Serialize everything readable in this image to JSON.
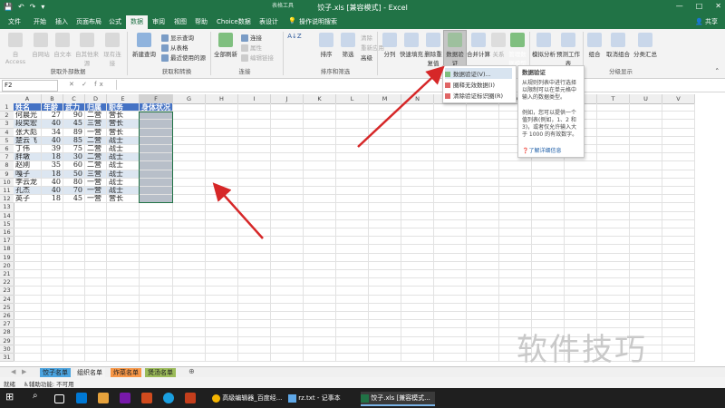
{
  "title_bar": {
    "quick_access": [
      "💾",
      "↶",
      "↷",
      "▾"
    ],
    "table_tools": "表格工具",
    "title": "饺子.xls [兼容模式] - Excel",
    "window_controls": [
      "—",
      "□",
      "✕"
    ]
  },
  "tabs": [
    "文件",
    "开始",
    "插入",
    "页面布局",
    "公式",
    "数据",
    "审阅",
    "视图",
    "帮助",
    "Choice数据",
    "表设计"
  ],
  "active_tab": "数据",
  "tell_me": "操作说明搜索",
  "share": "共享",
  "ribbon": {
    "get_external": {
      "buttons": [
        "自 Access",
        "自网站",
        "自文本",
        "自其他来源",
        "现有连接"
      ],
      "label": "获取外部数据"
    },
    "get_transform": {
      "new_query": "新建查询",
      "small": [
        "显示查询",
        "从表格",
        "最近使用的源"
      ],
      "label": "获取和转换"
    },
    "connections": {
      "refresh": "全部刷新",
      "small": [
        "连接",
        "属性",
        "编辑链接"
      ],
      "label": "连接"
    },
    "sort_filter": {
      "sort_az": "A↓Z",
      "sort": "排序",
      "filter": "筛选",
      "small": [
        "清除",
        "重新应用",
        "高级"
      ],
      "label": "排序和筛选"
    },
    "data_tools": {
      "buttons": [
        "分列",
        "快速填充",
        "删除重复值",
        "数据验证",
        "合并计算",
        "关系",
        "管理数据模型"
      ],
      "label": "数据工具"
    },
    "forecast": {
      "buttons": [
        "模拟分析",
        "预测工作表"
      ],
      "label": "预测"
    },
    "outline": {
      "buttons": [
        "组合",
        "取消组合",
        "分类汇总"
      ],
      "label": "分级显示"
    }
  },
  "data_validation_menu": {
    "items": [
      "数据验证(V)...",
      "圈释无效数据(I)",
      "清除验证标识圈(R)"
    ]
  },
  "tooltip": {
    "title": "数据验证",
    "body1": "从规则列表中进行选择以限制可以在单元格中输入的数据类型。",
    "body2": "例如，您可以提供一个值列表(例如，1、2 和 3)，或者仅允许输入大于 1000 的有效数字。",
    "link": "了解详细信息"
  },
  "formula_bar": {
    "name_box": "F2",
    "fx": "✕ ✓ fx"
  },
  "columns": [
    "A",
    "B",
    "C",
    "D",
    "E",
    "F",
    "G",
    "H",
    "I",
    "J",
    "K",
    "L",
    "M",
    "N",
    "O",
    "P",
    "Q",
    "R",
    "S",
    "T",
    "U",
    "V"
  ],
  "row_numbers": [
    "1",
    "2",
    "3",
    "4",
    "5",
    "6",
    "7",
    "8",
    "9",
    "10",
    "11",
    "12",
    "13",
    "14",
    "15",
    "16",
    "17",
    "18",
    "19",
    "20",
    "21",
    "22",
    "23",
    "24",
    "25",
    "26",
    "27",
    "28",
    "29",
    "30",
    "31"
  ],
  "table": {
    "headers": [
      "姓名",
      "年龄",
      "武力",
      "归属",
      "职务",
      "身体状况"
    ],
    "rows": [
      [
        "何晨光",
        "27",
        "90",
        "二营",
        "营长",
        ""
      ],
      [
        "段奕宏",
        "40",
        "45",
        "三营",
        "营长",
        ""
      ],
      [
        "张大彪",
        "34",
        "89",
        "一营",
        "营长",
        ""
      ],
      [
        "楚云飞",
        "40",
        "85",
        "二营",
        "战士",
        ""
      ],
      [
        "丁伟",
        "39",
        "75",
        "二营",
        "战士",
        ""
      ],
      [
        "胖墩",
        "18",
        "30",
        "二营",
        "战士",
        ""
      ],
      [
        "赵刚",
        "35",
        "60",
        "二营",
        "战士",
        ""
      ],
      [
        "嘎子",
        "18",
        "50",
        "三营",
        "战士",
        ""
      ],
      [
        "李云龙",
        "40",
        "80",
        "一营",
        "战士",
        ""
      ],
      [
        "孔杰",
        "40",
        "70",
        "一营",
        "战士",
        ""
      ],
      [
        "英子",
        "18",
        "45",
        "一营",
        "营长",
        ""
      ]
    ]
  },
  "sheet_tabs": [
    {
      "label": "饺子名单",
      "color": "#4aa3df"
    },
    {
      "label": "组织名单",
      "color": "#f3f3f3"
    },
    {
      "label": "炸菜名单",
      "color": "#f79646"
    },
    {
      "label": "煲汤名单",
      "color": "#9bbb59"
    }
  ],
  "sheet_add": "⊕",
  "status": {
    "ready": "就绪",
    "accessibility": "辅助功能: 不可用"
  },
  "taskbar": {
    "apps": [
      "高级编辑器_百度经...",
      "rz.txt - 记事本",
      "饺子.xls [兼容模式..."
    ]
  },
  "watermark": "软件技巧",
  "colors": {
    "excel_green": "#217346",
    "header_blue": "#4472c4",
    "band_blue": "#dce6f1",
    "arrow_red": "#d62728"
  }
}
